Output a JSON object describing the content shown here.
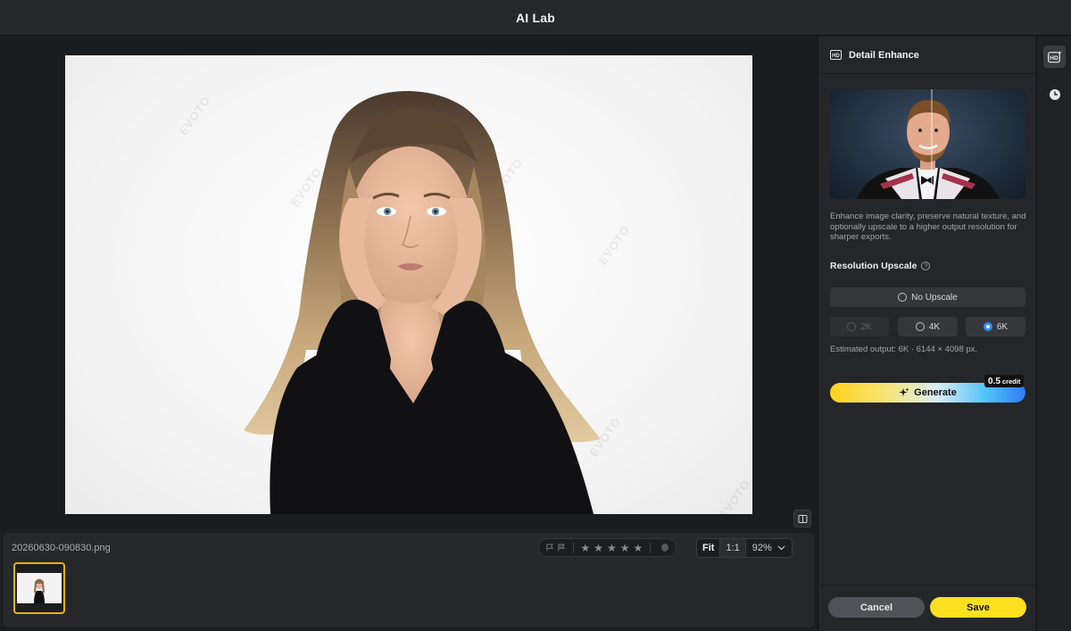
{
  "window": {
    "title": "AI Lab"
  },
  "canvas": {
    "watermark": "EVOTO",
    "compare_icon": "split-compare-icon"
  },
  "filmstrip": {
    "filename": "20260630-090830.png",
    "rating": {
      "stars": 0,
      "max_stars": 5
    },
    "zoom": {
      "fit_label": "Fit",
      "one_to_one_label": "1:1",
      "percent": "92%"
    }
  },
  "panel": {
    "title": "Detail Enhance",
    "title_icon": "hd-enhance-icon",
    "description": "Enhance image clarity, preserve natural texture, and optionally upscale to a higher output resolution for sharper exports.",
    "resolution_title": "Resolution Upscale",
    "options": {
      "none": "No Upscale",
      "k2": "2K",
      "k4": "4K",
      "k6": "6K"
    },
    "selected_option": "6K",
    "estimated_output": "Estimated output: 6K · 6144 × 4098 px.",
    "generate_label": "Generate",
    "credit_value": "0.5",
    "credit_unit": "credit",
    "cancel_label": "Cancel",
    "save_label": "Save"
  },
  "colors": {
    "accent_yellow": "#fde01f",
    "selected_blue": "#2f8df5",
    "thumb_border": "#e0b416"
  }
}
